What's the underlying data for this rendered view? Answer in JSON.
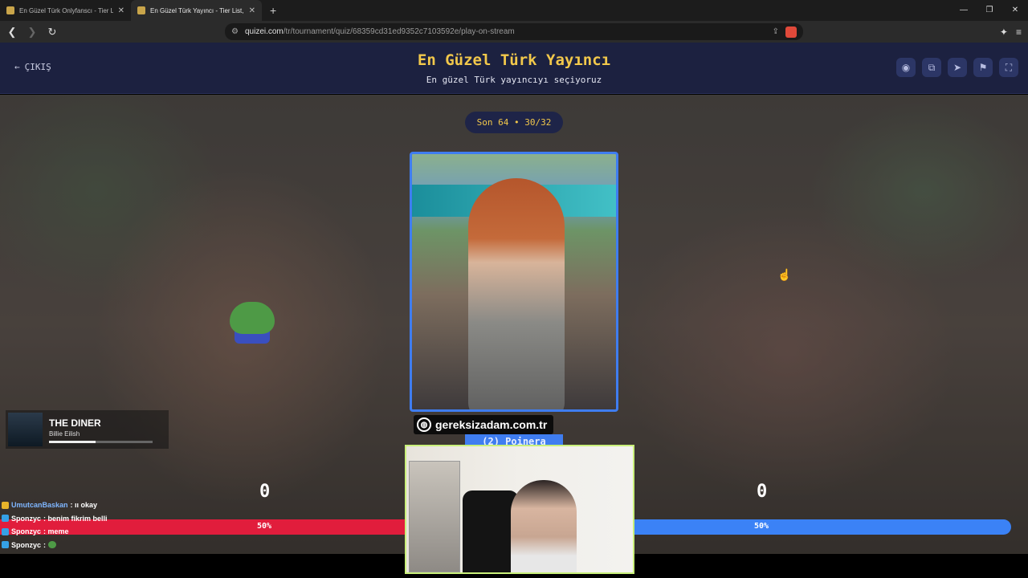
{
  "browser": {
    "tabs": [
      {
        "label": "En Güzel Türk Onlyfanscı - Tier List, K",
        "active": false
      },
      {
        "label": "En Güzel Türk Yayıncı - Tier List, K",
        "active": true
      }
    ],
    "new_tab": "+",
    "url_domain": "quizei.com",
    "url_path": "/tr/tournament/quiz/68359cd31ed9352c7103592e/play-on-stream"
  },
  "header": {
    "exit_label": "ÇIKIŞ",
    "title": "En Güzel Türk Yayıncı",
    "subtitle": "En güzel Türk yayıncıyı seçiyoruz",
    "buttons": [
      "eye-icon",
      "share-icon",
      "send-icon",
      "flag-icon",
      "fullscreen-icon"
    ]
  },
  "tournament": {
    "round_label": "Son 64 • 30/32",
    "candidate_name": "(2) Poinera",
    "site_watermark": "gereksizadam.com.tr",
    "left_score": "0",
    "right_score": "0",
    "left_percent": "50%",
    "right_percent": "50%",
    "left_fraction": 0.5,
    "right_fraction": 0.5
  },
  "music": {
    "song": "THE DINER",
    "artist": "Billie Eilish",
    "progress": 0.45
  },
  "chat": [
    {
      "user": "UmutcanBaskan",
      "text": ": ıı okay",
      "badge": "gold"
    },
    {
      "user": "Sponzyc",
      "text": ": benim fikrim belli",
      "badge": "blue"
    },
    {
      "user": "Sponzyc",
      "text": ": meme",
      "badge": "blue"
    },
    {
      "user": "Sponzyc",
      "text": ":",
      "badge": "blue"
    }
  ],
  "colors": {
    "accent_gold": "#f2c84b",
    "header_bg": "#1c2140",
    "blue": "#3b82f6",
    "red": "#e11d3c"
  }
}
